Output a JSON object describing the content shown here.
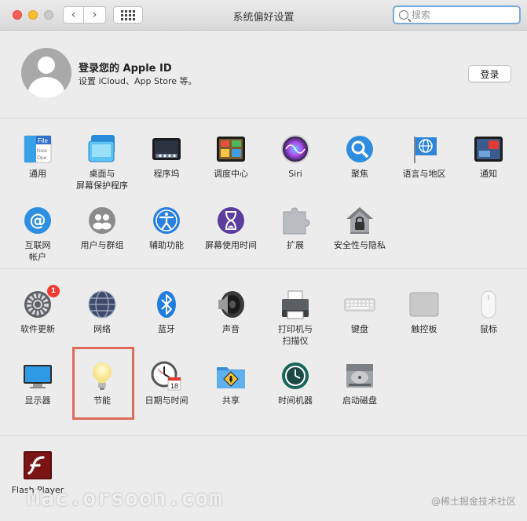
{
  "window": {
    "title": "系统偏好设置"
  },
  "toolbar": {
    "back": "‹",
    "forward": "›",
    "search_placeholder": "搜索",
    "search_value": ""
  },
  "apple_id": {
    "title": "登录您的 Apple ID",
    "subtitle": "设置 iCloud、App Store 等。",
    "login_label": "登录"
  },
  "section1": [
    {
      "label": "通用",
      "icon": "general-icon"
    },
    {
      "label": "桌面与\n屏幕保护程序",
      "icon": "desktop-screensaver-icon"
    },
    {
      "label": "程序坞",
      "icon": "dock-icon"
    },
    {
      "label": "调度中心",
      "icon": "mission-control-icon"
    },
    {
      "label": "Siri",
      "icon": "siri-icon"
    },
    {
      "label": "聚焦",
      "icon": "spotlight-icon"
    },
    {
      "label": "语言与地区",
      "icon": "language-region-icon"
    },
    {
      "label": "通知",
      "icon": "notifications-icon"
    },
    {
      "label": "互联网\n帐户",
      "icon": "internet-accounts-icon"
    },
    {
      "label": "用户与群组",
      "icon": "users-groups-icon"
    },
    {
      "label": "辅助功能",
      "icon": "accessibility-icon"
    },
    {
      "label": "屏幕使用时间",
      "icon": "screen-time-icon"
    },
    {
      "label": "扩展",
      "icon": "extensions-icon"
    },
    {
      "label": "安全性与隐私",
      "icon": "security-privacy-icon"
    }
  ],
  "section2": [
    {
      "label": "软件更新",
      "icon": "software-update-icon",
      "badge": "1"
    },
    {
      "label": "网络",
      "icon": "network-icon"
    },
    {
      "label": "蓝牙",
      "icon": "bluetooth-icon"
    },
    {
      "label": "声音",
      "icon": "sound-icon"
    },
    {
      "label": "打印机与\n扫描仪",
      "icon": "printers-scanners-icon"
    },
    {
      "label": "键盘",
      "icon": "keyboard-icon"
    },
    {
      "label": "触控板",
      "icon": "trackpad-icon"
    },
    {
      "label": "鼠标",
      "icon": "mouse-icon"
    },
    {
      "label": "显示器",
      "icon": "displays-icon"
    },
    {
      "label": "节能",
      "icon": "energy-saver-icon"
    },
    {
      "label": "日期与时间",
      "icon": "date-time-icon",
      "calendar_day": "18"
    },
    {
      "label": "共享",
      "icon": "sharing-icon"
    },
    {
      "label": "时间机器",
      "icon": "time-machine-icon"
    },
    {
      "label": "启动磁盘",
      "icon": "startup-disk-icon"
    }
  ],
  "section3": [
    {
      "label": "Flash Player",
      "icon": "flash-player-icon"
    }
  ],
  "watermark": "Mac.orsoon.com",
  "credit": "@稀土掘金技术社区"
}
